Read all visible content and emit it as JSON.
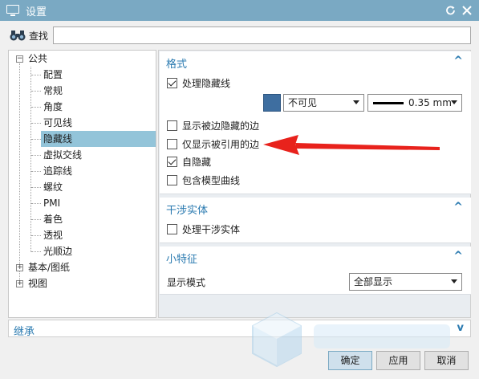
{
  "window": {
    "title": "设置",
    "icon": "monitor-icon",
    "actions": [
      "refresh-icon",
      "close-icon"
    ]
  },
  "search": {
    "label": "查找",
    "value": "",
    "placeholder": ""
  },
  "tree": {
    "items": [
      {
        "label": "公共",
        "level": 0,
        "expanded": true
      },
      {
        "label": "配置",
        "level": 1
      },
      {
        "label": "常规",
        "level": 1
      },
      {
        "label": "角度",
        "level": 1
      },
      {
        "label": "可见线",
        "level": 1
      },
      {
        "label": "隐藏线",
        "level": 1,
        "selected": true
      },
      {
        "label": "虚拟交线",
        "level": 1
      },
      {
        "label": "追踪线",
        "level": 1
      },
      {
        "label": "螺纹",
        "level": 1
      },
      {
        "label": "PMI",
        "level": 1
      },
      {
        "label": "着色",
        "level": 1
      },
      {
        "label": "透视",
        "level": 1
      },
      {
        "label": "光顺边",
        "level": 1
      },
      {
        "label": "基本/图纸",
        "level": 0,
        "expanded": false
      },
      {
        "label": "视图",
        "level": 0,
        "expanded": false
      }
    ]
  },
  "sections": {
    "format": {
      "title": "格式",
      "process_hidden": {
        "label": "处理隐藏线",
        "checked": true
      },
      "color": "#3e6ea0",
      "visibility": "不可见",
      "line_width": "0.35 mm",
      "show_edge_hidden": {
        "label": "显示被边隐藏的边",
        "checked": false
      },
      "show_referenced_only": {
        "label": "仅显示被引用的边",
        "checked": false
      },
      "self_hidden": {
        "label": "自隐藏",
        "checked": true
      },
      "include_model_curves": {
        "label": "包含模型曲线",
        "checked": false
      }
    },
    "interference": {
      "title": "干涉实体",
      "process": {
        "label": "处理干涉实体",
        "checked": false
      }
    },
    "small_features": {
      "title": "小特征",
      "display_mode_label": "显示模式",
      "display_mode_value": "全部显示"
    }
  },
  "inherit": {
    "label": "继承"
  },
  "buttons": {
    "ok": "确定",
    "apply": "应用",
    "cancel": "取消"
  },
  "colors": {
    "titlebar": "#7aa9c3",
    "accent": "#2a7ab0",
    "selection": "#93c4d9",
    "annotation_arrow": "#e8221c"
  }
}
